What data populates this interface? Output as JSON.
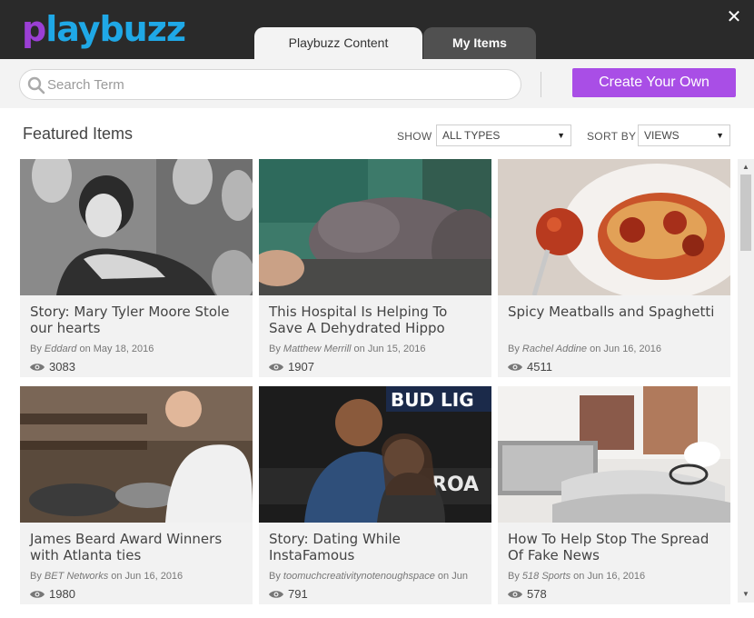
{
  "brand": {
    "logo_text": "playbuzz",
    "logo_first_letter": "p",
    "logo_rest": "laybuzz"
  },
  "tabs": [
    {
      "label": "Playbuzz Content",
      "active": true
    },
    {
      "label": "My Items",
      "active": false
    }
  ],
  "search": {
    "placeholder": "Search Term",
    "value": ""
  },
  "create_button": {
    "label": "Create Your Own"
  },
  "featured": {
    "title": "Featured Items",
    "show_label": "SHOW",
    "show_value": "ALL TYPES",
    "sort_label": "SORT BY",
    "sort_value": "VIEWS"
  },
  "items": [
    {
      "title": "Story: Mary Tyler Moore Stole our hearts",
      "by": "By",
      "author": "Eddard",
      "on": "on May 18, 2016",
      "views": "3083"
    },
    {
      "title": "This Hospital Is Helping To Save A Dehydrated Hippo",
      "by": "By",
      "author": "Matthew Merrill",
      "on": "on Jun 15, 2016",
      "views": "1907"
    },
    {
      "title": "Spicy Meatballs and Spaghetti",
      "by": "By",
      "author": "Rachel Addine",
      "on": "on Jun 16, 2016",
      "views": "4511"
    },
    {
      "title": "James Beard Award Winners with Atlanta ties",
      "by": "By",
      "author": "BET Networks",
      "on": "on Jun 16, 2016",
      "views": "1980"
    },
    {
      "title": "Story: Dating While InstaFamous",
      "by": "By",
      "author": "toomuchcreativitynotenoughspace",
      "on": "on Jun",
      "views": "791"
    },
    {
      "title": "How To Help Stop The Spread Of Fake News",
      "by": "By",
      "author": "518 Sports",
      "on": "on Jun 16, 2016",
      "views": "578"
    }
  ],
  "colors": {
    "header_bg": "#2a2a2a",
    "accent_purple": "#a94ee6",
    "logo_blue": "#1fa8e6",
    "logo_purple": "#9b3fd4"
  },
  "icons": {
    "close": "close-icon",
    "search": "search-icon",
    "views": "eye-icon",
    "select": "caret-down-icon"
  }
}
